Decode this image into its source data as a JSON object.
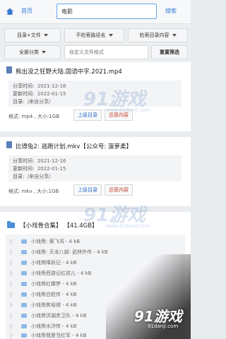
{
  "topbar": {
    "home_label": "首页",
    "search_value": "电影",
    "search_button": "搜索"
  },
  "filters": {
    "row1": [
      "目录+文件",
      "不检索路径名",
      "检索目录内容"
    ],
    "category": "全部分类",
    "custom_format_placeholder": "自定义文件格式",
    "reset_label": "重置筛选"
  },
  "results": [
    {
      "title": "熊出没之狂野大陆.国语中字.2021.mp4",
      "share_time_label": "分享时间:",
      "share_time": "2021-12-16",
      "update_time_label": "更新时间:",
      "update_time": "2022-01-15",
      "dir_label": "目录:",
      "dir": "/来自分享/",
      "format_line": "格式: mp4 ,  大小:1GB",
      "up_dir_label": "上级目录",
      "restore_label": "还原内容"
    },
    {
      "title": "比得兔2: 逃跑计划.mkv【公众号: 菠萝柔】",
      "share_time_label": "分享时间:",
      "share_time": "2021-12-16",
      "update_time_label": "更新时间:",
      "update_time": "2022-01-15",
      "dir_label": "目录:",
      "dir": "/来自分享/",
      "format_line": "格式: mkv ,  大小:1GB",
      "up_dir_label": "上级目录",
      "restore_label": "还原内容"
    }
  ],
  "folder": {
    "title": "【小戏骨合集】 【41.4GB】",
    "items": [
      "小戏骨: 黄飞鸿 - 4 kB",
      "小戏骨: 天龙八部: 武林外传 - 4 kB",
      "小戏骨降妖记 - 4 kB",
      "小戏骨西游记红孩儿 - 4 kB",
      "小戏骨红楼梦 - 4 kB",
      "小戏骨白蛇传 - 4 kB",
      "小戏骨焦裕禄 - 4 kB",
      "小戏骨洪湖赤卫队 - 4 kB",
      "小戏骨水浒传 - 4 kB",
      "小戏骨我爱当红军 - 4 kB"
    ]
  },
  "watermark": {
    "logo": "91游戏",
    "url": "www.91danji.com",
    "corner_url": "91danji.com"
  }
}
